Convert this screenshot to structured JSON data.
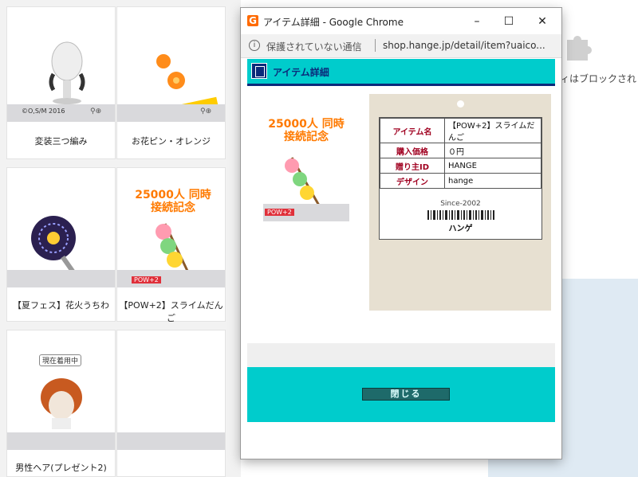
{
  "shop": {
    "items": [
      {
        "caption": "変装三つ編み",
        "copyright": "©O,S/M 2016"
      },
      {
        "caption": "お花ピン・オレンジ"
      },
      {
        "caption": "【夏フェス】花火うちわ"
      },
      {
        "caption": "【POW+2】スライムだんご",
        "badge": "POW+2",
        "banner": "25000人 同時接続記念"
      },
      {
        "caption": "男性ヘア(プレゼント2)",
        "status": "現在着用中"
      },
      {
        "caption": ""
      }
    ]
  },
  "background": {
    "blocked_text": "ィはブロックされ"
  },
  "window": {
    "title": "アイテム詳細 - Google Chrome",
    "controls": {
      "minimize": "–",
      "maximize": "☐",
      "close": "✕"
    },
    "address": {
      "insecure_label": "保護されていない通信",
      "url": "shop.hange.jp/detail/item?uaico..."
    }
  },
  "detail": {
    "header_title": "アイテム詳細",
    "banner": "25000人 同時接続記念",
    "badge": "POW+2",
    "card": {
      "rows": [
        {
          "key": "アイテム名",
          "value": "【POW+2】スライムだんご"
        },
        {
          "key": "購入価格",
          "value": "０円"
        },
        {
          "key": "贈り主ID",
          "value": "HANGE"
        },
        {
          "key": "デザイン",
          "value": "hange"
        }
      ],
      "since": "Since-2002",
      "brand": "ハンゲ"
    },
    "close_button": "閉じる"
  },
  "colors": {
    "accent": "#00cccc",
    "header_border": "#0b2a7a",
    "card_bg": "#e7e0d1"
  }
}
